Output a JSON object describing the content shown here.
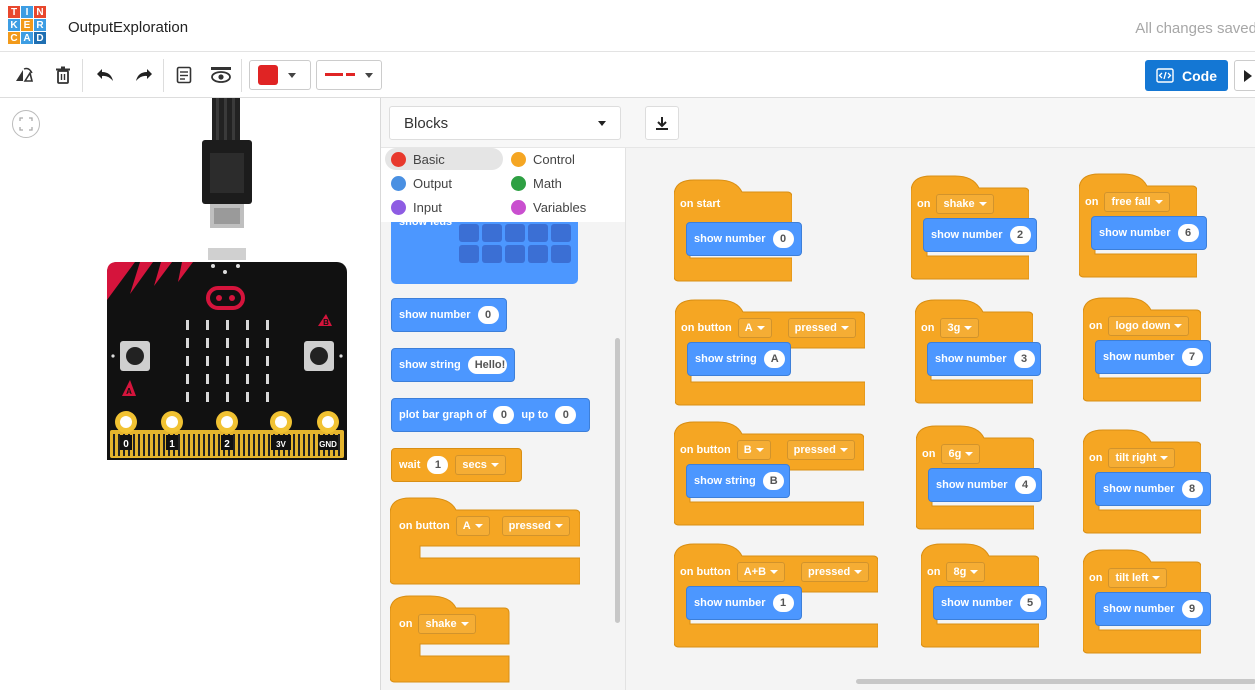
{
  "header": {
    "logo_letters": [
      "T",
      "I",
      "N",
      "K",
      "E",
      "R",
      "C",
      "A",
      "D"
    ],
    "logo_colors": [
      "#e8472d",
      "#3d9de3",
      "#e8472d",
      "#3d9de3",
      "#f29a1b",
      "#3d9de3",
      "#f29a1b",
      "#3d9de3",
      "#1f6fb2"
    ],
    "project_title": "OutputExploration",
    "save_status": "All changes saved"
  },
  "toolbar": {
    "icons": [
      "rotate-icon",
      "trash-icon",
      "undo-icon",
      "redo-icon",
      "notes-icon",
      "visibility-icon"
    ],
    "fill_color": "#e02424",
    "line_color": "#e02424",
    "code_label": "Code"
  },
  "code_panel": {
    "mode_dropdown": "Blocks",
    "categories": [
      {
        "label": "Basic",
        "color": "#e8392d"
      },
      {
        "label": "Control",
        "color": "#f5a623"
      },
      {
        "label": "Output",
        "color": "#4a90e2"
      },
      {
        "label": "Math",
        "color": "#2ea043"
      },
      {
        "label": "Input",
        "color": "#8e5ce3"
      },
      {
        "label": "Variables",
        "color": "#c94fcf"
      }
    ],
    "palette": {
      "show_leds_label": "show leds",
      "show_number": {
        "label": "show number",
        "value": "0"
      },
      "show_string": {
        "label": "show string",
        "value": "Hello!"
      },
      "plot_bar": {
        "label": "plot bar graph of",
        "value": "0",
        "upto_label": "up to",
        "upto_value": "0"
      },
      "wait": {
        "label": "wait",
        "value": "1",
        "unit": "secs"
      },
      "on_button": {
        "label": "on button",
        "button": "A",
        "action": "pressed"
      },
      "on_shake": {
        "label": "on",
        "event": "shake"
      }
    }
  },
  "workspace": {
    "on_start": {
      "label": "on start",
      "inner_label": "show number",
      "value": "0"
    },
    "col1": [
      {
        "label": "on button",
        "button": "A",
        "action": "pressed",
        "inner_label": "show string",
        "value": "A"
      },
      {
        "label": "on button",
        "button": "B",
        "action": "pressed",
        "inner_label": "show string",
        "value": "B"
      },
      {
        "label": "on button",
        "button": "A+B",
        "action": "pressed",
        "inner_label": "show number",
        "value": "1"
      }
    ],
    "col2": [
      {
        "label": "on",
        "event": "shake",
        "inner_label": "show number",
        "value": "2"
      },
      {
        "label": "on",
        "event": "3g",
        "inner_label": "show number",
        "value": "3"
      },
      {
        "label": "on",
        "event": "6g",
        "inner_label": "show number",
        "value": "4"
      },
      {
        "label": "on",
        "event": "8g",
        "inner_label": "show number",
        "value": "5"
      }
    ],
    "col3": [
      {
        "label": "on",
        "event": "free fall",
        "inner_label": "show number",
        "value": "6"
      },
      {
        "label": "on",
        "event": "logo down",
        "inner_label": "show number",
        "value": "7"
      },
      {
        "label": "on",
        "event": "tilt right",
        "inner_label": "show number",
        "value": "8"
      },
      {
        "label": "on",
        "event": "tilt left",
        "inner_label": "show number",
        "value": "9"
      }
    ]
  },
  "microbit": {
    "pins": [
      "0",
      "1",
      "2",
      "3V",
      "GND"
    ],
    "button_a": "A",
    "button_b": "B"
  }
}
